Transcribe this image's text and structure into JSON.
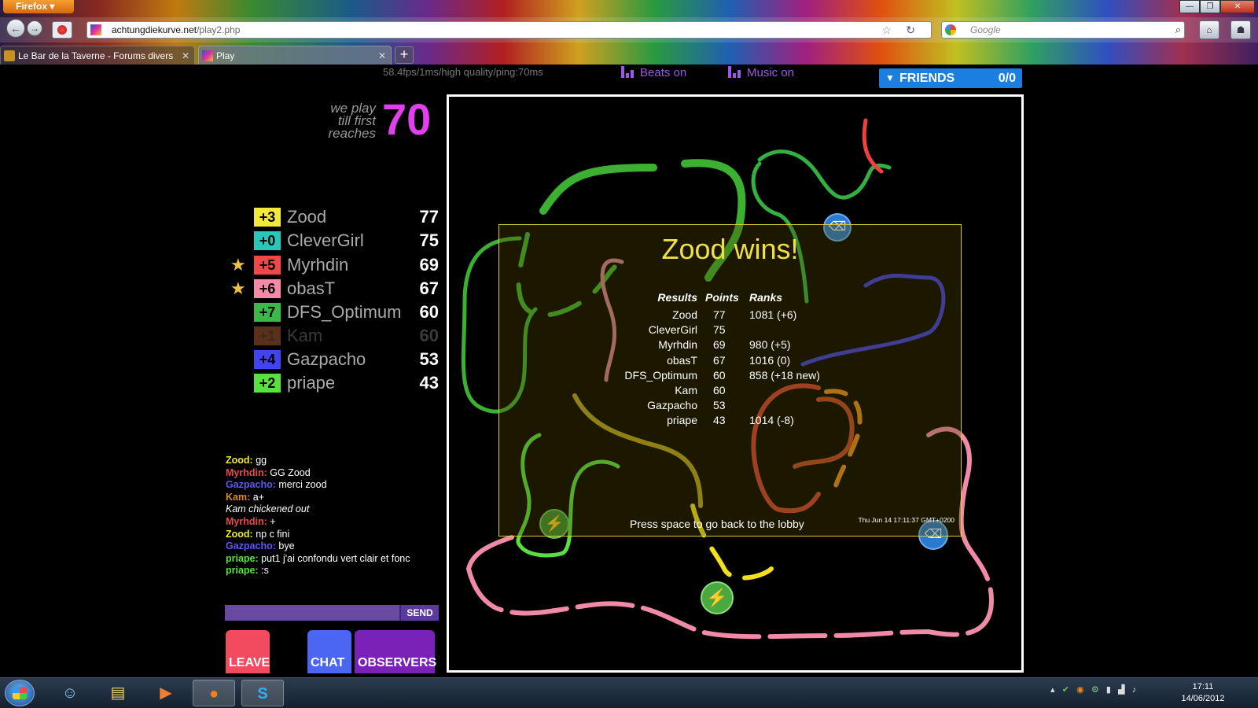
{
  "browser": {
    "menu_button": "Firefox",
    "url_domain": "achtungdiekurve.net",
    "url_path": "/play2.php",
    "search_placeholder": "Google",
    "tabs": [
      {
        "label": "Le Bar de la Taverne - Forums divers"
      },
      {
        "label": "Play"
      }
    ],
    "new_tab": "+"
  },
  "game": {
    "perf": "58.4fps/1ms/high quality/ping:70ms",
    "beats_toggle": "Beats on",
    "music_toggle": "Music on",
    "friends_label": "FRIENDS",
    "friends_count": "0/0",
    "till_text": [
      "we play",
      "till first",
      "reaches"
    ],
    "target_score": "70"
  },
  "players": [
    {
      "delta": "+3",
      "name": "Zood",
      "score": "77",
      "color": "#f2e83a",
      "star": false
    },
    {
      "delta": "+0",
      "name": "CleverGirl",
      "score": "75",
      "color": "#28c8b8",
      "star": false
    },
    {
      "delta": "+5",
      "name": "Myrhdin",
      "score": "69",
      "color": "#f04848",
      "star": true
    },
    {
      "delta": "+6",
      "name": "obasT",
      "score": "67",
      "color": "#f48aa8",
      "star": true
    },
    {
      "delta": "+7",
      "name": "DFS_Optimum",
      "score": "60",
      "color": "#3cb848",
      "star": false
    },
    {
      "delta": "+1",
      "name": "Kam",
      "score": "60",
      "color": "#5a3018",
      "star": false,
      "dimmed": true
    },
    {
      "delta": "+4",
      "name": "Gazpacho",
      "score": "53",
      "color": "#4444ee",
      "star": false
    },
    {
      "delta": "+2",
      "name": "priape",
      "score": "43",
      "color": "#5ae040",
      "star": false
    }
  ],
  "chat": [
    {
      "who": "Zood:",
      "msg": "gg",
      "color": "#f2e83a"
    },
    {
      "who": "Myrhdin:",
      "msg": "GG Zood",
      "color": "#f04848"
    },
    {
      "who": "Gazpacho:",
      "msg": "merci zood",
      "color": "#5a5af0"
    },
    {
      "who": "Kam:",
      "msg": "a+",
      "color": "#e08a20"
    },
    {
      "who": "",
      "msg": "Kam chickened out",
      "color": "#ffffff",
      "system": true
    },
    {
      "who": "Myrhdin:",
      "msg": "+",
      "color": "#f04848"
    },
    {
      "who": "Zood:",
      "msg": "np c fini",
      "color": "#f2e83a"
    },
    {
      "who": "Gazpacho:",
      "msg": "bye",
      "color": "#5a5af0"
    },
    {
      "who": "priape:",
      "msg": "put1 j'ai confondu vert clair et fonc",
      "color": "#5ae040"
    },
    {
      "who": "priape:",
      "msg": ":s",
      "color": "#5ae040"
    }
  ],
  "controls": {
    "send_label": "SEND",
    "leave_label": "LEAVE",
    "chat_label": "CHAT",
    "observers_label": "OBSERVERS"
  },
  "results": {
    "title": "Zood wins!",
    "headers": {
      "results": "Results",
      "points": "Points",
      "ranks": "Ranks"
    },
    "rows": [
      {
        "name": "Zood",
        "points": "77",
        "rank": "1081 (+6)"
      },
      {
        "name": "CleverGirl",
        "points": "75",
        "rank": ""
      },
      {
        "name": "Myrhdin",
        "points": "69",
        "rank": "980 (+5)"
      },
      {
        "name": "obasT",
        "points": "67",
        "rank": "1016 (0)"
      },
      {
        "name": "DFS_Optimum",
        "points": "60",
        "rank": "858 (+18 new)"
      },
      {
        "name": "Kam",
        "points": "60",
        "rank": ""
      },
      {
        "name": "Gazpacho",
        "points": "53",
        "rank": ""
      },
      {
        "name": "priape",
        "points": "43",
        "rank": "1014 (-8)"
      }
    ],
    "hint": "Press space to go back to the lobby",
    "timestamp": "Thu Jun 14 17:11:37 GMT+0200"
  },
  "taskbar": {
    "clock_time": "17:11",
    "clock_date": "14/06/2012"
  },
  "colors": {
    "target": "#e040ee",
    "friends_bg": "#1a7fe0",
    "toggle": "#9b59e6",
    "win_title": "#f0e040"
  }
}
